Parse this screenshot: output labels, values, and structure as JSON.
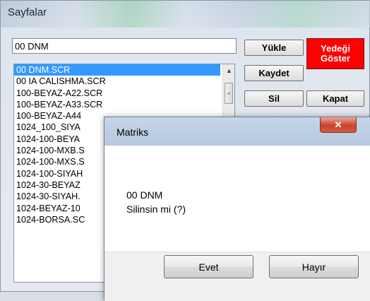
{
  "window": {
    "title": "Sayfalar"
  },
  "name_input": {
    "value": "00 DNM"
  },
  "buttons": {
    "yukle": "Yükle",
    "kaydet": "Kaydet",
    "sil": "Sil",
    "kapat": "Kapat",
    "yedegi_line1": "Yedeği",
    "yedegi_line2": "Göster"
  },
  "list": {
    "items": [
      "00 DNM.SCR",
      "00 IA CALISHMA.SCR",
      "100-BEYAZ-A22.SCR",
      "100-BEYAZ-A33.SCR",
      "100-BEYAZ-A44",
      "1024_100_SIYA",
      "1024-100-BEYA",
      "1024-100-MXB.S",
      "1024-100-MXS.S",
      "1024-100-SIYAH",
      "1024-30-BEYAZ",
      "1024-30-SIYAH.",
      "1024-BEYAZ-10",
      "1024-BORSA.SC"
    ],
    "selected_index": 0
  },
  "modal": {
    "title": "Matriks",
    "close_glyph": "✕",
    "message_line1": "00 DNM",
    "message_line2": "Silinsin mi (?)",
    "yes": "Evet",
    "no": "Hayır"
  },
  "colors": {
    "accent_red": "#ff0000",
    "selection": "#3399ff"
  }
}
